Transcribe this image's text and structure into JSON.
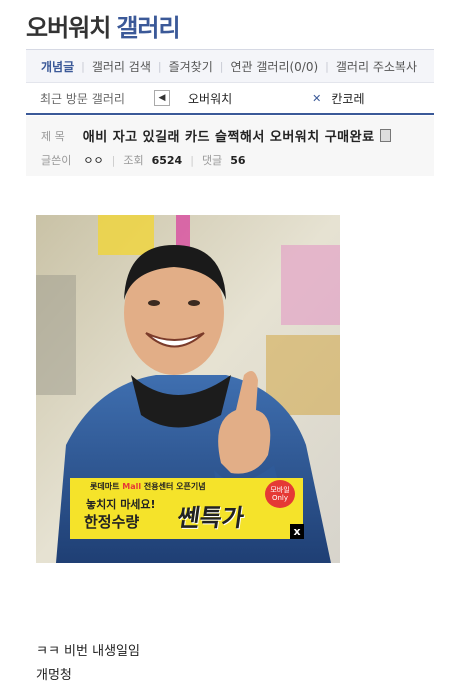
{
  "header": {
    "gallery_name": "오버워치",
    "gallery_suffix": "갤러리"
  },
  "tabs": [
    {
      "label": "개념글"
    },
    {
      "label": "갤러리 검색"
    },
    {
      "label": "즐겨찾기"
    },
    {
      "label": "연관 갤러리(0/0)"
    },
    {
      "label": "갤러리 주소복사"
    }
  ],
  "recent": {
    "label": "최근 방문 갤러리",
    "items": [
      "오버워치",
      "칸코레"
    ]
  },
  "post": {
    "subject_label": "제 목",
    "subject": "애비 자고 있길래 카드 슬쩍해서 오버워치 구매완료",
    "author_label": "글쓴이",
    "author": "ㅇㅇ",
    "views_label": "조회",
    "views": "6524",
    "comments_label": "댓글",
    "comments": "56"
  },
  "ad": {
    "brand": "롯데마트",
    "mall": "Mall",
    "headline": "전용센터 오픈기념",
    "line1": "놓치지 마세요!",
    "line2": "한정수량",
    "big": "쎈특가",
    "badge": "모바일 Only",
    "close": "x"
  },
  "body": {
    "line1": "ㅋㅋ 비번 내생일임",
    "line2": "개멍청"
  },
  "colors": {
    "accent": "#3b5998",
    "ad_bg": "#f5e32a"
  }
}
